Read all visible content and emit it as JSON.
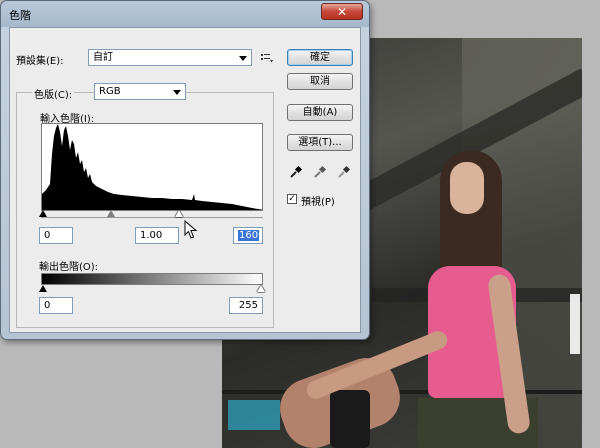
{
  "dialog": {
    "title": "色階",
    "close_glyph": "✕",
    "preset_label": "預設集(E):",
    "preset_value": "自訂",
    "presets_menu_icon": "list-options-icon",
    "channel_label": "色版(C):",
    "channel_value": "RGB",
    "input_levels_label": "輸入色階(I):",
    "input_black": "0",
    "input_gamma": "1.00",
    "input_white": "160",
    "output_levels_label": "輸出色階(O):",
    "output_black": "0",
    "output_white": "255"
  },
  "buttons": {
    "ok": "確定",
    "cancel": "取消",
    "auto": "自動(A)",
    "options": "選項(T)..."
  },
  "preview": {
    "label": "預視(P)",
    "checked": true,
    "check_glyph": "✓"
  },
  "eyedroppers": [
    "black-eyedropper-icon",
    "gray-eyedropper-icon",
    "white-eyedropper-icon"
  ]
}
